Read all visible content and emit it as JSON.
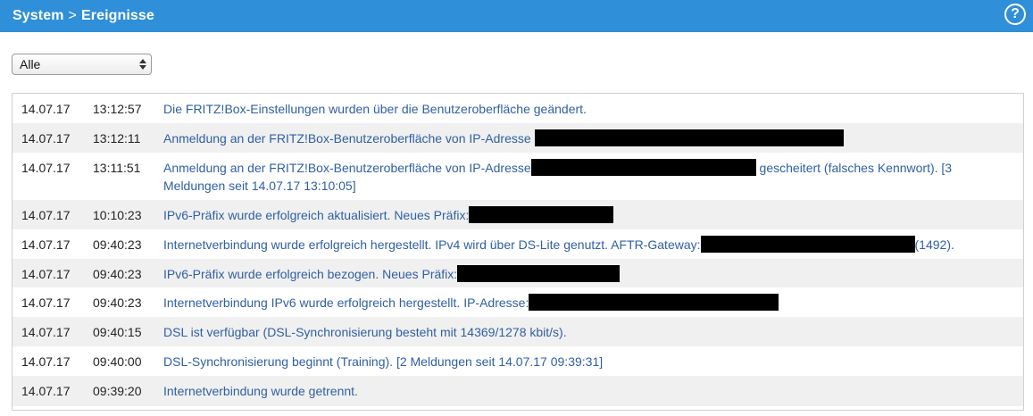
{
  "header": {
    "breadcrumb_parent": "System",
    "breadcrumb_sep": ">",
    "breadcrumb_current": "Ereignisse",
    "help_label": "?"
  },
  "filter": {
    "selected": "Alle"
  },
  "events": [
    {
      "date": "14.07.17",
      "time": "13:12:57",
      "parts": [
        "Die FRITZ!Box-Einstellungen wurden über die Benutzeroberfläche geändert."
      ]
    },
    {
      "date": "14.07.17",
      "time": "13:12:11",
      "parts": [
        "Anmeldung an der FRITZ!Box-Benutzeroberfläche von IP-Adresse "
      ]
    },
    {
      "date": "14.07.17",
      "time": "13:11:51",
      "parts": [
        "Anmeldung an der FRITZ!Box-Benutzeroberfläche von IP-Adresse",
        " gescheitert (falsches Kennwort). [3 Meldungen seit 14.07.17 13:10:05]"
      ]
    },
    {
      "date": "14.07.17",
      "time": "10:10:23",
      "parts": [
        "IPv6-Präfix wurde erfolgreich aktualisiert. Neues Präfix:"
      ]
    },
    {
      "date": "14.07.17",
      "time": "09:40:23",
      "parts": [
        "Internetverbindung wurde erfolgreich hergestellt. IPv4 wird über DS-Lite genutzt. AFTR-Gateway:",
        "(1492)."
      ]
    },
    {
      "date": "14.07.17",
      "time": "09:40:23",
      "parts": [
        "IPv6-Präfix wurde erfolgreich bezogen. Neues Präfix:"
      ]
    },
    {
      "date": "14.07.17",
      "time": "09:40:23",
      "parts": [
        "Internetverbindung IPv6 wurde erfolgreich hergestellt. IP-Adresse:"
      ]
    },
    {
      "date": "14.07.17",
      "time": "09:40:15",
      "parts": [
        "DSL ist verfügbar (DSL-Synchronisierung besteht mit 14369/1278 kbit/s)."
      ]
    },
    {
      "date": "14.07.17",
      "time": "09:40:00",
      "parts": [
        "DSL-Synchronisierung beginnt (Training). [2 Meldungen seit 14.07.17 09:39:31]"
      ]
    },
    {
      "date": "14.07.17",
      "time": "09:39:20",
      "parts": [
        "Internetverbindung wurde getrennt."
      ]
    }
  ],
  "colors": {
    "header_bg": "#2f8fd9",
    "link_text": "#2f5fa3",
    "redaction": "#000000",
    "row_stripe": "#f0f0f0"
  }
}
